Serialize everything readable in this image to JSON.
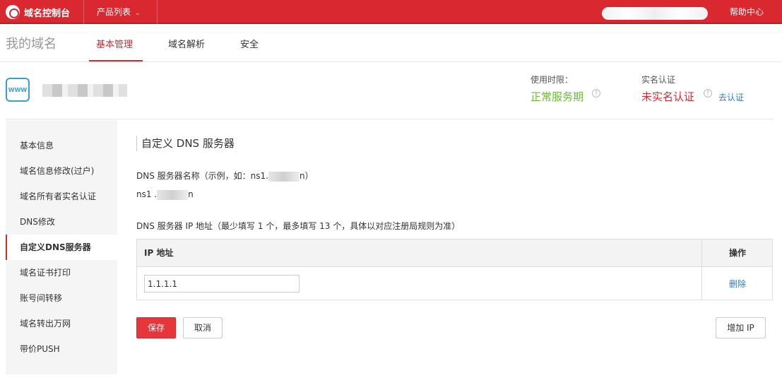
{
  "topbar": {
    "brand": "域名控制台",
    "products_label": "产品列表",
    "help_label": "帮助中心"
  },
  "tabs": {
    "my_domain": "我的域名",
    "items": [
      "基本管理",
      "域名解析",
      "安全"
    ]
  },
  "domain_info": {
    "icon_text": "WWW",
    "usage_label": "使用时限：",
    "usage_status": "正常服务期",
    "auth_label": "实名认证",
    "auth_status": "未实名认证",
    "auth_link": "去认证"
  },
  "sidebar": {
    "items": [
      "基本信息",
      "域名信息修改(过户)",
      "域名所有者实名认证",
      "DNS修改",
      "自定义DNS服务器",
      "域名证书打印",
      "账号间转移",
      "域名转出万网",
      "带价PUSH"
    ],
    "active_index": 4
  },
  "main": {
    "title": "自定义 DNS 服务器",
    "name_label_prefix": "DNS 服务器名称（示例，如：ns1.",
    "name_label_suffix": "n）",
    "name_value_prefix": "ns1 .",
    "name_value_suffix": "n",
    "ip_label": "DNS 服务器 IP 地址（最少填写 1 个，最多填写 13 个，具体以对应注册局规则为准）",
    "table": {
      "col_ip": "IP 地址",
      "col_op": "操作",
      "rows": [
        {
          "ip": "1.1.1.1",
          "action": "删除"
        }
      ]
    },
    "save_button": "保存",
    "cancel_button": "取消",
    "add_ip_button": "增加 IP"
  },
  "colors": {
    "brand_red": "#d9282f",
    "ok_green": "#6dbb3c",
    "link_blue": "#2d7bc4"
  }
}
